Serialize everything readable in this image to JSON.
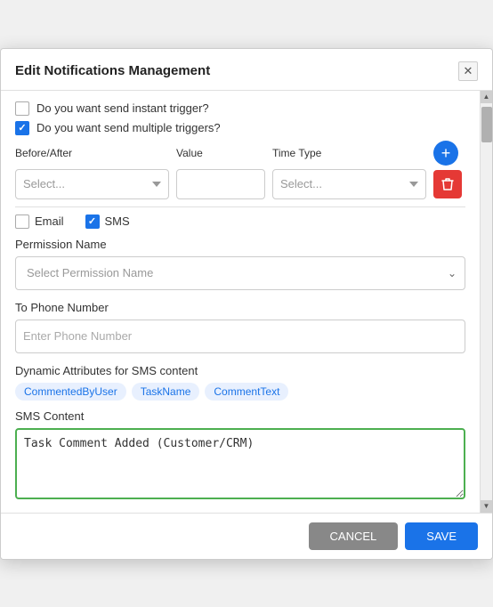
{
  "modal": {
    "title": "Edit Notifications Management",
    "close_label": "✕"
  },
  "checkboxes": {
    "instant_trigger": {
      "label": "Do you want send instant trigger?",
      "checked": false
    },
    "multiple_triggers": {
      "label": "Do you want send multiple triggers?",
      "checked": true
    }
  },
  "trigger_row": {
    "before_after_label": "Before/After",
    "value_label": "Value",
    "time_type_label": "Time Type",
    "before_after_placeholder": "Select...",
    "time_type_placeholder": "Select...",
    "value_placeholder": "",
    "add_icon": "+",
    "delete_icon": "🗑"
  },
  "channels": {
    "email_label": "Email",
    "email_checked": false,
    "sms_label": "SMS",
    "sms_checked": true
  },
  "permission": {
    "label": "Permission Name",
    "placeholder": "Select Permission Name"
  },
  "phone": {
    "label": "To Phone Number",
    "placeholder": "Enter Phone Number"
  },
  "dynamic_attrs": {
    "label": "Dynamic Attributes for SMS content",
    "tags": [
      "CommentedByUser",
      "TaskName",
      "CommentText"
    ]
  },
  "sms_content": {
    "label": "SMS Content",
    "value": "Task Comment Added (Customer/CRM)"
  },
  "footer": {
    "cancel_label": "CANCEL",
    "save_label": "SAVE"
  },
  "scrollbar": {
    "up_icon": "▲",
    "down_icon": "▼"
  }
}
